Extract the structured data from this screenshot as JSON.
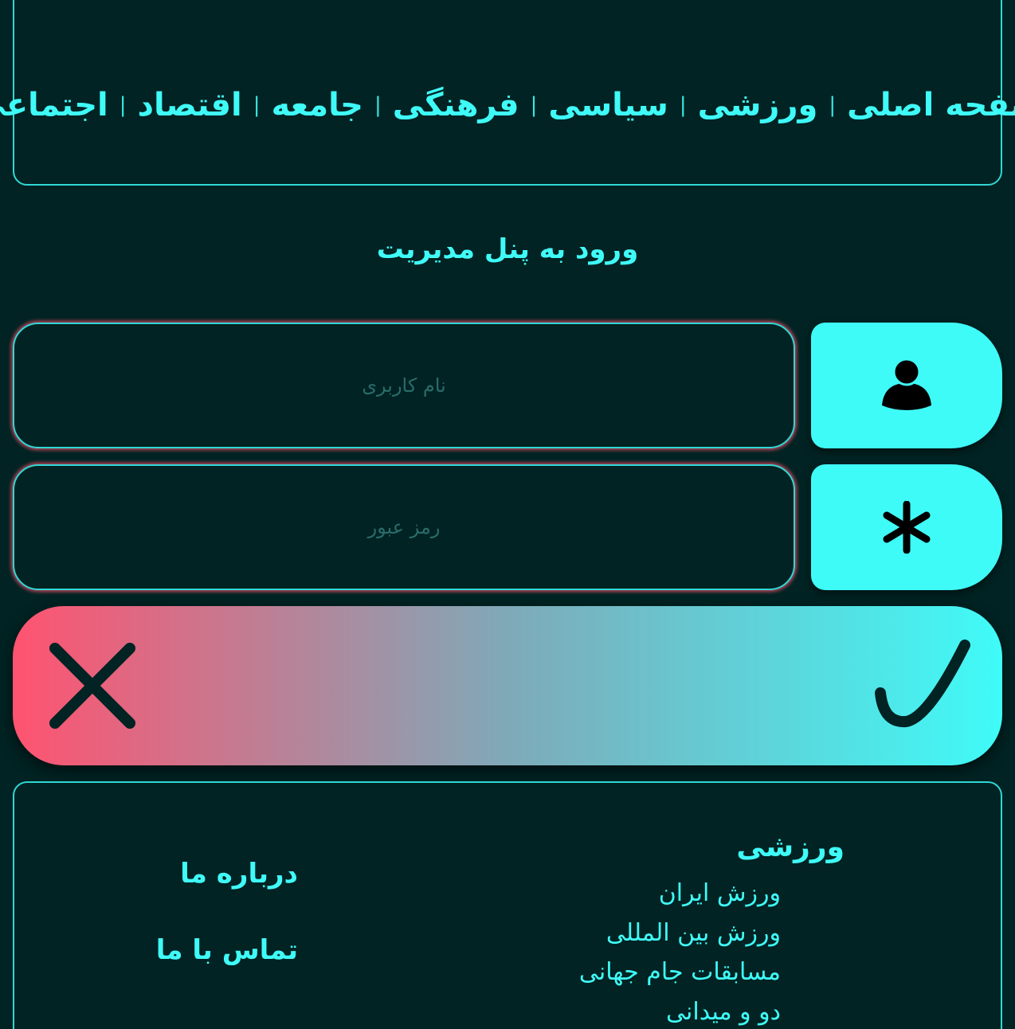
{
  "nav": {
    "items": [
      {
        "label": "صفحه اصلی"
      },
      {
        "label": "ورزشی"
      },
      {
        "label": "سیاسی"
      },
      {
        "label": "فرهنگی"
      },
      {
        "label": "جامعه"
      },
      {
        "label": "اقتصاد"
      },
      {
        "label": "اجتماعی"
      }
    ],
    "separator": "|"
  },
  "login": {
    "title": "ورود به پنل مدیریت",
    "username_placeholder": "نام کاربری",
    "password_placeholder": "رمز عبور"
  },
  "icons": {
    "username": "user-icon",
    "password": "asterisk-icon",
    "confirm": "checkmark-icon",
    "cancel": "close-icon"
  },
  "footer": {
    "sports_title": "ورزشی",
    "sports_links": [
      "ورزش ایران",
      "ورزش بین المللی",
      "مسابقات جام جهانی",
      "دو و میدانی"
    ],
    "about": "درباره ما",
    "contact": "تماس با ما"
  },
  "colors": {
    "background": "#012323",
    "accent": "#3ffbf8",
    "danger": "#ff5370"
  }
}
